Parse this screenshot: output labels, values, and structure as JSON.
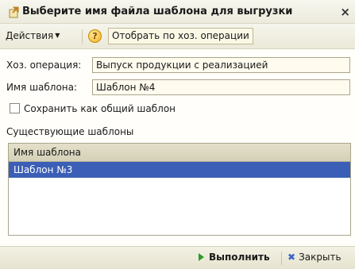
{
  "window": {
    "title": "Выберите имя файла шаблона для выгрузки",
    "close_glyph": "×"
  },
  "toolbar": {
    "actions_label": "Действия",
    "help_glyph": "?",
    "filter_button_label": "Отобрать по хоз. операции"
  },
  "form": {
    "operation_label": "Хоз. операция:",
    "operation_value": "Выпуск продукции с реализацией",
    "template_name_label": "Имя шаблона:",
    "template_name_value": "Шаблон №4",
    "save_common_label": "Сохранить как общий шаблон",
    "save_common_checked": false,
    "existing_templates_label": "Существующие шаблоны"
  },
  "table": {
    "column_header": "Имя шаблона",
    "rows": [
      {
        "name": "Шаблон №3",
        "selected": true
      }
    ]
  },
  "bottombar": {
    "run_label": "Выполнить",
    "close_label": "Закрыть"
  },
  "colors": {
    "selection": "#3b5fb6",
    "run_icon": "#2e9a2e",
    "close_icon": "#3d64c4",
    "help_icon": "#f2b21f"
  },
  "icons": {
    "title": "template-export-icon",
    "help": "help-icon",
    "run": "play-icon",
    "close": "close-x-icon"
  }
}
